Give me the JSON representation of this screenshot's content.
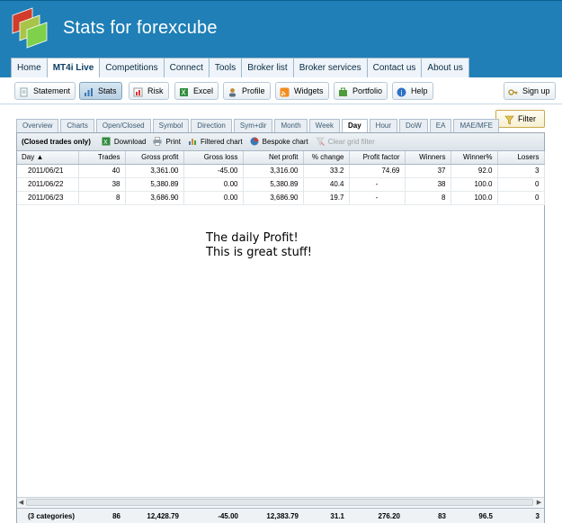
{
  "app": {
    "title": "Stats for forexcube"
  },
  "mainnav": {
    "items": [
      {
        "label": "Home"
      },
      {
        "label": "MT4i Live",
        "active": true
      },
      {
        "label": "Competitions"
      },
      {
        "label": "Connect"
      },
      {
        "label": "Tools"
      },
      {
        "label": "Broker list"
      },
      {
        "label": "Broker services"
      },
      {
        "label": "Contact us"
      },
      {
        "label": "About us"
      }
    ]
  },
  "toolbar": {
    "statement": "Statement",
    "stats": "Stats",
    "risk": "Risk",
    "excel": "Excel",
    "profile": "Profile",
    "widgets": "Widgets",
    "portfolio": "Portfolio",
    "help": "Help",
    "signup": "Sign up"
  },
  "tabs": [
    {
      "label": "Overview"
    },
    {
      "label": "Charts"
    },
    {
      "label": "Open/Closed"
    },
    {
      "label": "Symbol"
    },
    {
      "label": "Direction"
    },
    {
      "label": "Sym+dir"
    },
    {
      "label": "Month"
    },
    {
      "label": "Week"
    },
    {
      "label": "Day",
      "active": true
    },
    {
      "label": "Hour"
    },
    {
      "label": "DoW"
    },
    {
      "label": "EA"
    },
    {
      "label": "MAE/MFE"
    }
  ],
  "filter_label": "Filter",
  "grid": {
    "caption": "(Closed trades only)",
    "download": "Download",
    "print": "Print",
    "filtered_chart": "Filtered chart",
    "bespoke_chart": "Bespoke chart",
    "clear_filter": "Clear grid filter",
    "columns": [
      "Day ▲",
      "Trades",
      "Gross profit",
      "Gross loss",
      "Net profit",
      "% change",
      "Profit factor",
      "Winners",
      "Winner%",
      "Losers"
    ],
    "rows": [
      [
        "2011/06/21",
        "40",
        "3,361.00",
        "-45.00",
        "3,316.00",
        "33.2",
        "74.69",
        "37",
        "92.0",
        "3"
      ],
      [
        "2011/06/22",
        "38",
        "5,380.89",
        "0.00",
        "5,380.89",
        "40.4",
        "-",
        "38",
        "100.0",
        "0"
      ],
      [
        "2011/06/23",
        "8",
        "3,686.90",
        "0.00",
        "3,686.90",
        "19.7",
        "-",
        "8",
        "100.0",
        "0"
      ]
    ],
    "summary": [
      "(3 categories)",
      "86",
      "12,428.79",
      "-45.00",
      "12,383.79",
      "31.1",
      "276.20",
      "83",
      "96.5",
      "3"
    ]
  },
  "annotation": {
    "line1": "The daily Profit!",
    "line2": "This is great stuff!"
  },
  "colors": {
    "header": "#1f7fb6",
    "accent": "#0b3f66"
  }
}
